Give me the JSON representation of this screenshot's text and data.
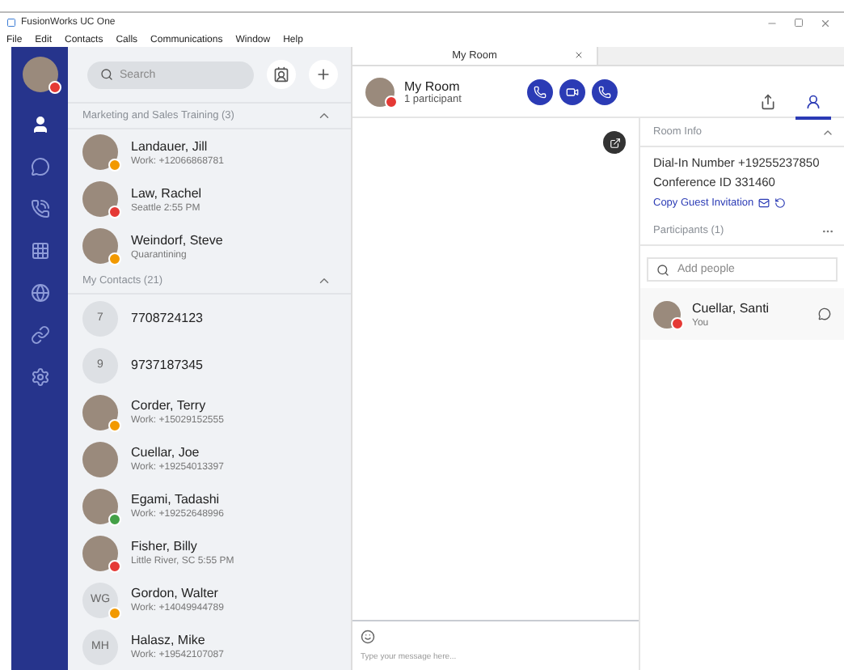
{
  "window": {
    "title": "FusionWorks UC One"
  },
  "menu": [
    "File",
    "Edit",
    "Contacts",
    "Calls",
    "Communications",
    "Window",
    "Help"
  ],
  "nav": {
    "self": {
      "color": "#e53935"
    },
    "items": [
      {
        "kind": "contacts",
        "selected": true
      },
      {
        "kind": "chat",
        "selected": false
      },
      {
        "kind": "calls",
        "selected": false
      },
      {
        "kind": "dialpad",
        "selected": false
      },
      {
        "kind": "globe",
        "selected": false
      },
      {
        "kind": "link",
        "selected": false
      },
      {
        "kind": "settings",
        "selected": false
      }
    ]
  },
  "contacts": {
    "search": {
      "placeholder": "Search"
    },
    "groups": [
      {
        "title": "Marketing and Sales Training (3)",
        "expanded": true,
        "items": [
          {
            "name": "Landauer, Jill",
            "detail": "Work: +12066868781",
            "color": "#f29900"
          },
          {
            "name": "Law, Rachel",
            "detail": "Seattle 2:55 PM",
            "color": "#e53935"
          },
          {
            "name": "Weindorf, Steve",
            "detail": "Quarantining",
            "color": "#f29900"
          }
        ]
      },
      {
        "title": "My Contacts (21)",
        "expanded": true,
        "items": [
          {
            "name": "7708724123",
            "initials": "7"
          },
          {
            "name": "9737187345",
            "initials": "9"
          },
          {
            "name": "Corder, Terry",
            "detail": "Work: +15029152555",
            "color": "#f29900"
          },
          {
            "name": "Cuellar, Joe",
            "detail": "Work: +19254013397"
          },
          {
            "name": "Egami, Tadashi",
            "detail": "Work: +19252648996",
            "color": "#43a047"
          },
          {
            "name": "Fisher, Billy",
            "detail": "Little River, SC 5:55 PM",
            "color": "#e53935"
          },
          {
            "name": "Gordon, Walter",
            "detail": "Work: +14049944789",
            "initials": "WG",
            "color": "#f29900"
          },
          {
            "name": "Halasz, Mike",
            "detail": "Work: +19542107087",
            "initials": "MH"
          }
        ]
      }
    ]
  },
  "tabs": [
    {
      "label": "My Room",
      "selected": true
    }
  ],
  "room": {
    "name": "My Room",
    "subtitle": "1 participant",
    "color": "#e53935"
  },
  "side_tabs": [
    {
      "kind": "share",
      "selected": false
    },
    {
      "kind": "people",
      "selected": true
    }
  ],
  "room_info": {
    "title": "Room Info",
    "expanded": true,
    "dial_in": "Dial-In Number +19255237850",
    "conference": "Conference ID 331460",
    "copy_link": "Copy Guest Invitation",
    "participants_title": "Participants (1)",
    "add": {
      "placeholder": "Add people"
    },
    "participants": [
      {
        "name": "Cuellar, Santi",
        "detail": "You",
        "color": "#e53935"
      }
    ]
  },
  "composer": {
    "placeholder": "Type your message here..."
  }
}
